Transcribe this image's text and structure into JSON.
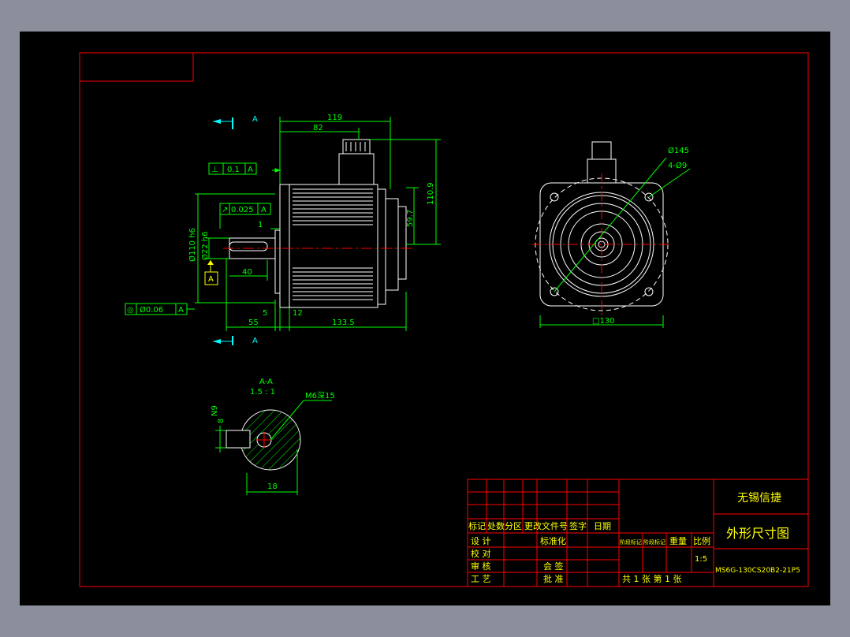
{
  "colors": {
    "background": "#000000",
    "border": "#ff0000",
    "geometry": "#ffffff",
    "dimension": "#00ff00",
    "center_line": "#ff0000",
    "view_marker": "#00ffff",
    "title_text": "#ffff00",
    "viewport_outer": "#8a8f9b"
  },
  "views": {
    "section_marker_top": "A",
    "section_marker_bottom": "A"
  },
  "front_view": {
    "dims": {
      "overall_length": "119",
      "body_length": "82",
      "height_top": "110.9",
      "height_axis": "59.7",
      "pilot_diameter": "Ø110 h6",
      "shaft_diameter": "Ø22 h6",
      "shaft_length_key": "40",
      "shaft_total": "55",
      "flange_thickness": "5",
      "flange_offset": "12",
      "body_total": "133.5",
      "shoulder": "1"
    },
    "tolerances": {
      "perpendicularity": {
        "symbol": "⊥",
        "value": "0.1",
        "datum": "A"
      },
      "runout": {
        "symbol": "↗",
        "value": "0.025",
        "datum": "A"
      },
      "concentricity": {
        "symbol": "◎",
        "value": "Ø0.06",
        "datum": "A"
      }
    },
    "datum_label": "A"
  },
  "end_view": {
    "bolt_circle": "Ø145",
    "holes": "4-Ø9",
    "square": "□130"
  },
  "section_view": {
    "title": "A-A",
    "scale": "1.5 : 1",
    "thread": "M6深15",
    "key_width_label": "N9",
    "key_width": "8",
    "key_depth": "18"
  },
  "title_block": {
    "company": "无锡信捷",
    "drawing_title": "外形尺寸图",
    "drawing_number": "MS6G-130CS20B2-21P5",
    "header_row": [
      "标记",
      "处数",
      "分区",
      "更改文件号",
      "签字",
      "日期"
    ],
    "rows": [
      {
        "role": "设 计",
        "sig": "标准化"
      },
      {
        "role": "校 对",
        "sig": ""
      },
      {
        "role": "审 核",
        "sig": "会 签"
      },
      {
        "role": "工 艺",
        "sig": "批 准"
      }
    ],
    "stage_label_1": "阶段标记",
    "stage_label_2": "阶段标记",
    "weight_label": "重量",
    "scale_label": "比例",
    "scale_value": "1:5",
    "sheet_text": "共 1 张 第 1 张"
  }
}
